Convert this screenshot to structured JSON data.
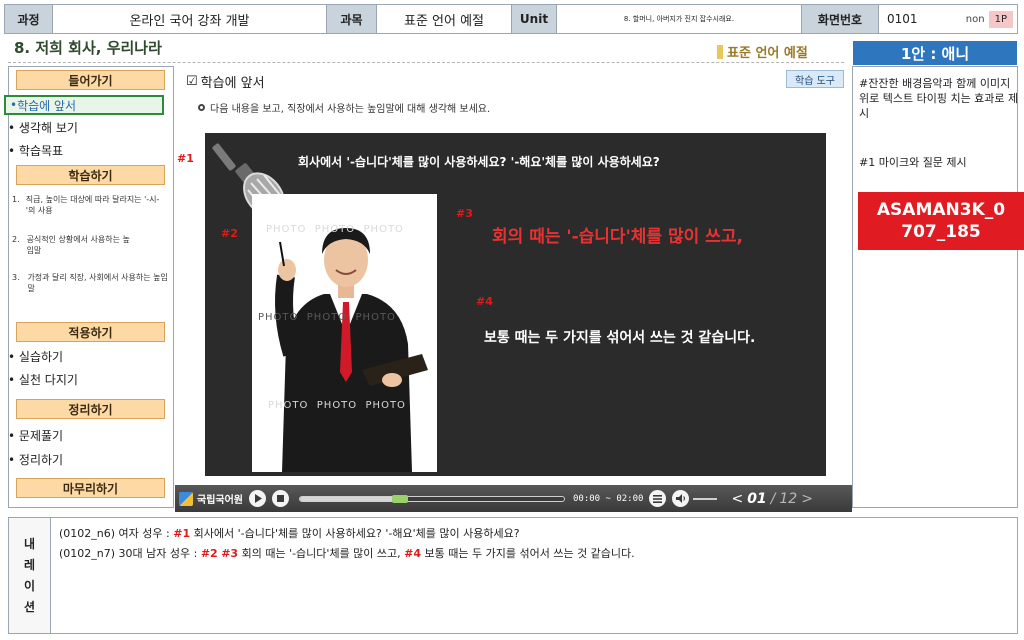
{
  "topbar": {
    "course_label": "과정",
    "course_value": "온라인 국어 강좌 개발",
    "subject_label": "과목",
    "subject_value": "표준 언어 예절",
    "unit_label": "Unit",
    "unit_value": "8. 할머니, 아버지가 진지 잡수시래요.",
    "screen_label": "화면번호",
    "screen_value": "0101",
    "non_label": "non",
    "page_badge": "1P"
  },
  "page": {
    "title": "8. 저희 회사, 우리나라",
    "subject_tag": "표준 언어 예절"
  },
  "menu": {
    "sec1": "들어가기",
    "sec1_items": [
      "학습에 앞서",
      "생각해 보기",
      "학습목표"
    ],
    "sec2": "학습하기",
    "sec2_items": [
      {
        "num": "1.",
        "text": "직급, 높이는 대상에 따라 달라지는 '-시-'의 사용"
      },
      {
        "num": "2.",
        "text": "공식적인 상황에서 사용하는 높임말"
      },
      {
        "num": "3.",
        "text": "가정과 달리 직장, 사회에서 사용하는 높임말"
      }
    ],
    "sec3": "적용하기",
    "sec3_items": [
      "실습하기",
      "실천 다지기"
    ],
    "sec4": "정리하기",
    "sec4_items": [
      "문제풀기",
      "정리하기"
    ],
    "sec5": "마무리하기"
  },
  "content": {
    "heading": "학습에 앞서",
    "tool_button": "학습 도구",
    "instruction": "다음 내용을 보고, 직장에서 사용하는 높임말에 대해 생각해 보세요.",
    "question": "회사에서 '-습니다'체를 많이 사용하세요? '-해요'체를 많이 사용하세요?",
    "answer_red": "회의 때는 '-습니다'체를 많이 쓰고,",
    "answer_white": "보통 때는 두 가지를 섞어서 쓰는 것 같습니다.",
    "marker1": "#1",
    "marker2": "#2",
    "marker3": "#3",
    "marker4": "#4",
    "watermark": "PHOTO"
  },
  "player": {
    "brand": "국립국어원",
    "time": "00:00 ~ 02:00",
    "progress": 0.38,
    "current_page": "01",
    "total_pages": "12"
  },
  "notes": {
    "plan_title": "1안 : 애니",
    "note1": "#잔잔한 배경음악과 함께 이미지 위로 텍스트 타이핑 치는 효과로 제시",
    "note2": "#1 마이크와 질문 제시",
    "id_stamp": "ASAMAN3K_0707_185"
  },
  "narration": {
    "label_chars": [
      "내",
      "레",
      "이",
      "션"
    ],
    "line1_prefix": "(0102_n6) 여자 성우 :",
    "line1_marker": "#1",
    "line1_text": "회사에서 '-습니다'체를 많이 사용하세요? '-해요'체를 많이 사용하세요?",
    "line2_prefix": "(0102_n7) 30대 남자 성우 :",
    "line2_marker_a": "#2",
    "line2_marker_b": "#3",
    "line2_text_a": "회의 때는 '-습니다'체를 많이 쓰고,",
    "line2_marker_c": "#4",
    "line2_text_b": "보통 때는 두 가지를 섞어서 쓰는 것 같습니다."
  }
}
